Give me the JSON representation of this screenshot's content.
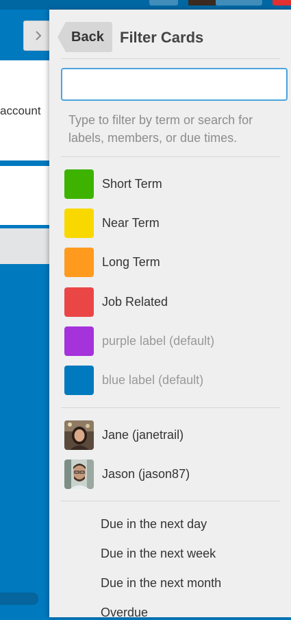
{
  "background": {
    "card_text": "account"
  },
  "panel": {
    "back_label": "Back",
    "title": "Filter Cards",
    "search_value": "",
    "help_text": "Type to filter by term or search for labels, members, or due times."
  },
  "labels": [
    {
      "name": "Short Term",
      "color": "#3db300",
      "muted": false
    },
    {
      "name": "Near Term",
      "color": "#f9d800",
      "muted": false
    },
    {
      "name": "Long Term",
      "color": "#ff9a1f",
      "muted": false
    },
    {
      "name": "Job Related",
      "color": "#eb4646",
      "muted": false
    },
    {
      "name": "purple label (default)",
      "color": "#a632db",
      "muted": true
    },
    {
      "name": "blue label (default)",
      "color": "#0079bf",
      "muted": true
    }
  ],
  "members": [
    {
      "name": "Jane (janetrail)",
      "avatar": "jane-avatar"
    },
    {
      "name": "Jason (jason87)",
      "avatar": "jason-avatar"
    }
  ],
  "due": [
    {
      "label": "Due in the next day"
    },
    {
      "label": "Due in the next week"
    },
    {
      "label": "Due in the next month"
    },
    {
      "label": "Overdue"
    }
  ]
}
